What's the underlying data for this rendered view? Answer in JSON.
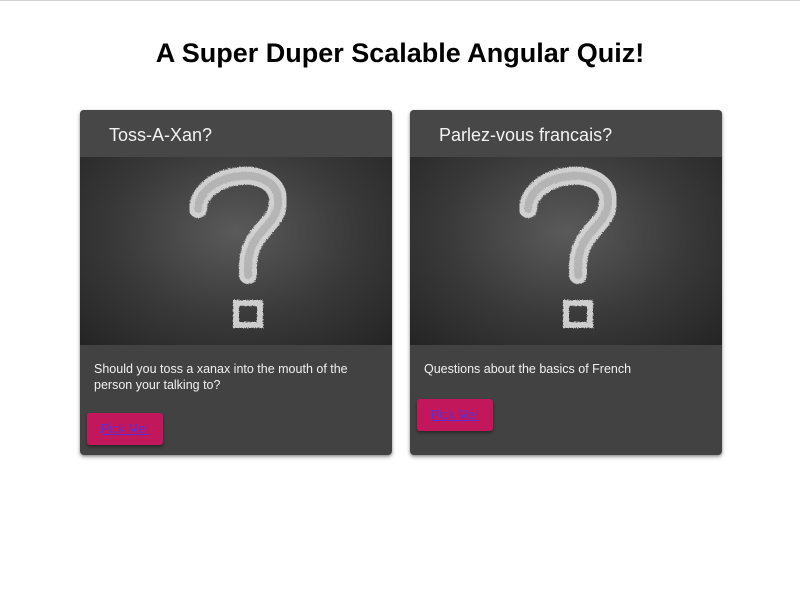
{
  "page": {
    "title": "A Super Duper Scalable Angular Quiz!"
  },
  "quizzes": [
    {
      "title": "Toss-A-Xan?",
      "image_icon": "question-mark-chalk-icon",
      "description": "Should you toss a xanax into the mouth of the person your talking to?",
      "button_label": "Pick Me!"
    },
    {
      "title": "Parlez-vous francais?",
      "image_icon": "question-mark-chalk-icon",
      "description": "Questions about the basics of French",
      "button_label": "Pick Me!"
    }
  ],
  "colors": {
    "card_background": "#424242",
    "button_background": "#c2185b",
    "button_text": "#5c2fd0"
  }
}
